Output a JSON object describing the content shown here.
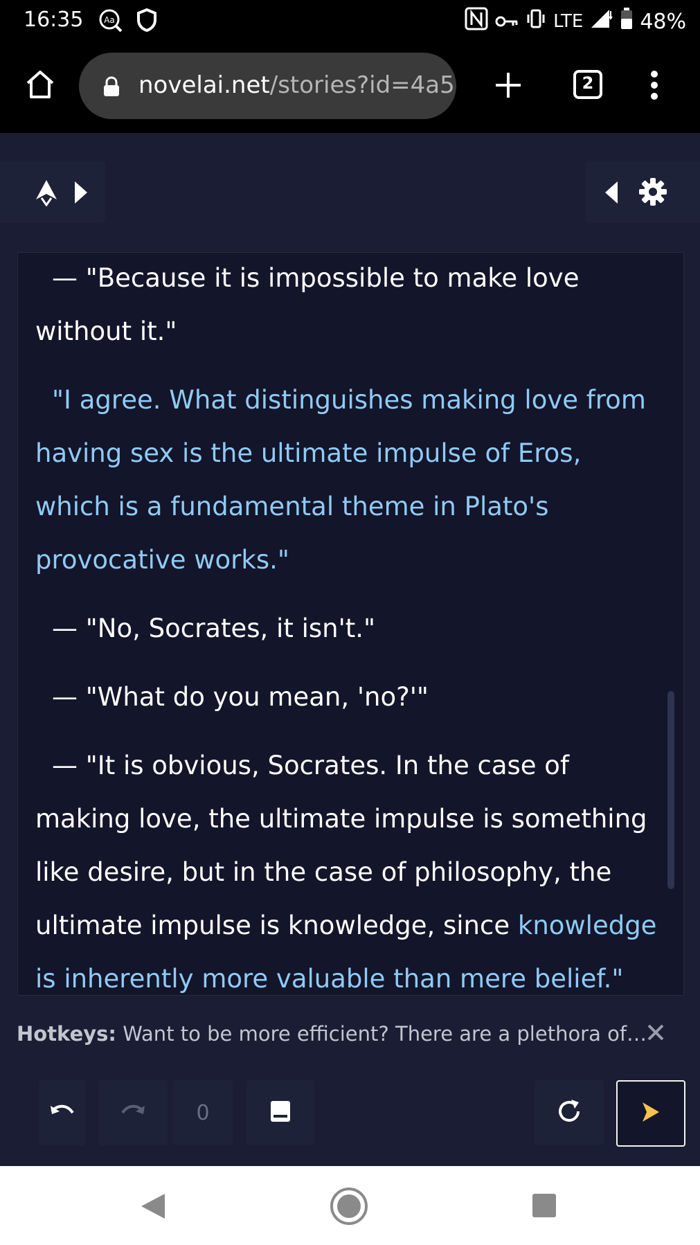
{
  "status_bar": {
    "time": "16:35",
    "network": "LTE",
    "battery": "48%"
  },
  "browser": {
    "url_host": "novelai.net",
    "url_path": "/stories?id=4a5",
    "tab_count": "2"
  },
  "story": {
    "paragraphs": [
      {
        "user": "— \"Because it is impossible to make love without it.\"",
        "ai": ""
      },
      {
        "user": "",
        "ai": "\"I agree. What distinguishes making love from having sex is the ultimate impulse of Eros, which is a fundamental theme in Plato's provocative works.\""
      },
      {
        "user": "— \"No, Socrates, it isn't.\"",
        "ai": ""
      },
      {
        "user": "— \"What do you mean, 'no?'\"",
        "ai": ""
      },
      {
        "user": "— \"It is obvious, Socrates. In the case of making love, the ultimate impulse is something like desire, but in the case of philosophy, the ultimate impulse is knowledge, since ",
        "ai": "knowledge is inherently more valuable than mere belief.\""
      }
    ]
  },
  "tip": {
    "label": "Hotkeys:",
    "text": " Want to be more efficient? There are a plethora of…"
  },
  "controls": {
    "retry_count": "0"
  },
  "colors": {
    "background": "#1a1d33",
    "editor_bg": "#13152a",
    "ai_text": "#8fcbf5",
    "user_text": "#ffffff"
  }
}
